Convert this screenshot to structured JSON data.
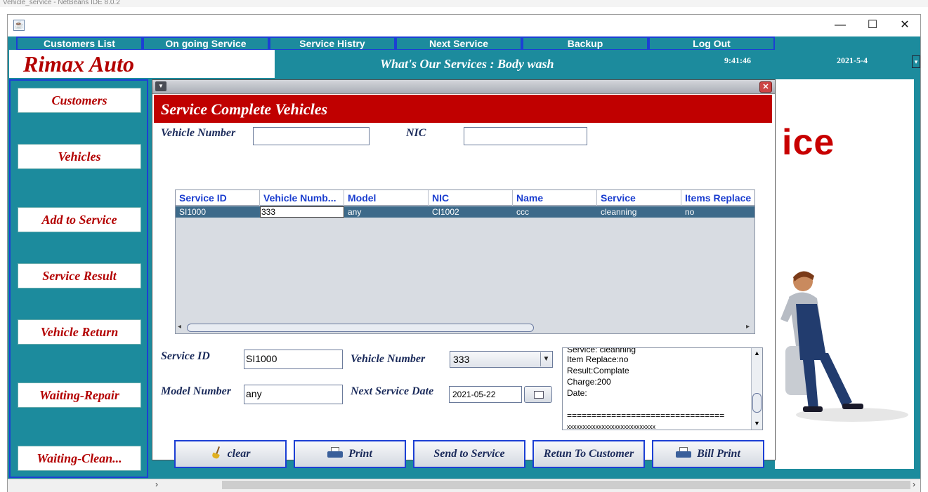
{
  "ide": {
    "title": "Vehicle_service - NetBeans IDE 8.0.2"
  },
  "window": {
    "min": "—",
    "max": "☐",
    "close": "✕"
  },
  "nav": [
    "Customers List",
    "On going Service",
    "Service Histry",
    "Next Service",
    "Backup",
    "Log Out"
  ],
  "brand": "Rimax Auto",
  "header": {
    "services_label": "What's Our Services :  Body wash",
    "time": "9:41:46",
    "date": "2021-5-4"
  },
  "sidebar": [
    "Customers",
    "Vehicles",
    "Add to Service",
    "Service Result",
    "Vehicle Return",
    "Waiting-Repair",
    "Waiting-Clean..."
  ],
  "background_word": "ice",
  "dialog": {
    "title": "Service Complete Vehicles",
    "search": {
      "vehicle_label": "Vehicle Number",
      "vehicle_value": "",
      "nic_label": "NIC",
      "nic_value": ""
    },
    "table": {
      "columns": [
        "Service ID",
        "Vehicle Numb...",
        "Model",
        "NIC",
        "Name",
        "Service",
        "Items Replace"
      ],
      "rows": [
        [
          "SI1000",
          "333",
          "any",
          "CI1002",
          "ccc",
          "cleanning",
          "no"
        ]
      ]
    },
    "form": {
      "service_id_label": "Service ID",
      "service_id_value": "SI1000",
      "vehicle_number_label": "Vehicle Number",
      "vehicle_number_value": "333",
      "model_label": "Model Number",
      "model_value": "any",
      "next_date_label": "Next Service Date",
      "next_date_value": "2021-05-22"
    },
    "notes": [
      "Service: cleanning",
      "Item Replace:no",
      "Result:Complate",
      "Charge:200",
      "Date:",
      "",
      "================================",
      "xxxxxxxxxxxxxxxxxxxxxxxxxxxx"
    ],
    "buttons": [
      "clear",
      "Print",
      "Send to Service",
      "Retun To Customer",
      "Bill Print"
    ]
  }
}
